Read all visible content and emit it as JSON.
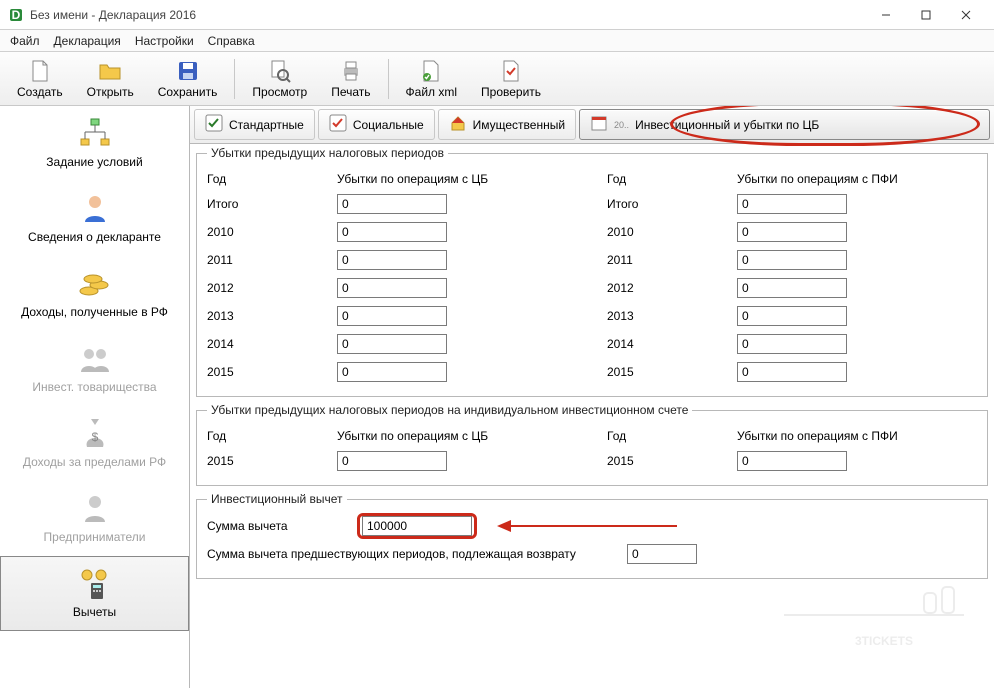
{
  "window": {
    "title": "Без имени - Декларация 2016"
  },
  "menu": {
    "file": "Файл",
    "decl": "Декларация",
    "settings": "Настройки",
    "help": "Справка"
  },
  "toolbar": {
    "create": "Создать",
    "open": "Открыть",
    "save": "Сохранить",
    "preview": "Просмотр",
    "print": "Печать",
    "xml": "Файл xml",
    "check": "Проверить"
  },
  "sidebar": {
    "items": [
      {
        "label": "Задание условий",
        "disabled": false
      },
      {
        "label": "Сведения о декларанте",
        "disabled": false
      },
      {
        "label": "Доходы, полученные в РФ",
        "disabled": false
      },
      {
        "label": "Инвест. товарищества",
        "disabled": true
      },
      {
        "label": "Доходы за пределами РФ",
        "disabled": true
      },
      {
        "label": "Предприниматели",
        "disabled": true
      },
      {
        "label": "Вычеты",
        "disabled": false,
        "selected": true
      }
    ]
  },
  "tabs": {
    "std": "Стандартные",
    "soc": "Социальные",
    "prop": "Имущественный",
    "inv": "Инвестиционный и убытки по ЦБ",
    "inv_short": "20.."
  },
  "groups": {
    "g1": "Убытки предыдущих налоговых периодов",
    "g2": "Убытки предыдущих налоговых периодов на индивидуальном инвестиционном счете",
    "g3": "Инвестиционный вычет"
  },
  "headers": {
    "year": "Год",
    "loss_cb": "Убытки по операциям с ЦБ",
    "loss_pfi": "Убытки по операциям с ПФИ",
    "total": "Итого"
  },
  "years": [
    "2010",
    "2011",
    "2012",
    "2013",
    "2014",
    "2015"
  ],
  "values": {
    "total_cb": "0",
    "total_pfi": "0",
    "cb": {
      "2010": "0",
      "2011": "0",
      "2012": "0",
      "2013": "0",
      "2014": "0",
      "2015": "0"
    },
    "pfi": {
      "2010": "0",
      "2011": "0",
      "2012": "0",
      "2013": "0",
      "2014": "0",
      "2015": "0"
    },
    "iis_year": "2015",
    "iis_cb": "0",
    "iis_pfi": "0",
    "deduction_label": "Сумма вычета",
    "deduction": "100000",
    "prev_label": "Сумма вычета предшествующих периодов, подлежащая возврату",
    "prev_value": "0"
  },
  "watermark": "3TICKETS"
}
